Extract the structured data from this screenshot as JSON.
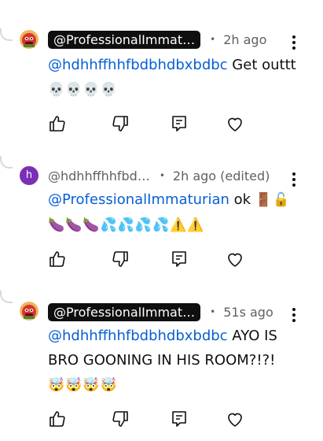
{
  "comments": [
    {
      "author": "@ProfessionalImmaturian",
      "author_display": "@ProfessionalImmat…",
      "time": "2h ago",
      "mention": "@hdhhffhhfbdbhdbxbdbc",
      "text": " Get outtt ",
      "emojis": "💀💀💀💀",
      "avatar": "red-cartoon-avatar"
    },
    {
      "author": "@hdhhffhhfbd…",
      "time": "2h ago (edited)",
      "mention": "@ProfessionalImmaturian",
      "text": " ok ",
      "emojis": "🚪🔓🍆🍆🍆💦💦💦💦⚠️⚠️",
      "avatar_letter": "h",
      "avatar_color": "#7b2fb5"
    },
    {
      "author": "@ProfessionalImmaturian",
      "author_display": "@ProfessionalImmat…",
      "time": "51s ago",
      "mention": "@hdhhffhhfbdbhdbxbdbc",
      "text": " AYO IS BRO GOONING IN HIS ROOM?!?! ",
      "emojis": "🤯🤯🤯🤯",
      "avatar": "red-cartoon-avatar"
    }
  ],
  "icons": {
    "like": "thumbs-up-icon",
    "dislike": "thumbs-down-icon",
    "reply": "reply-icon",
    "heart": "heart-icon",
    "more": "more-vert-icon"
  }
}
